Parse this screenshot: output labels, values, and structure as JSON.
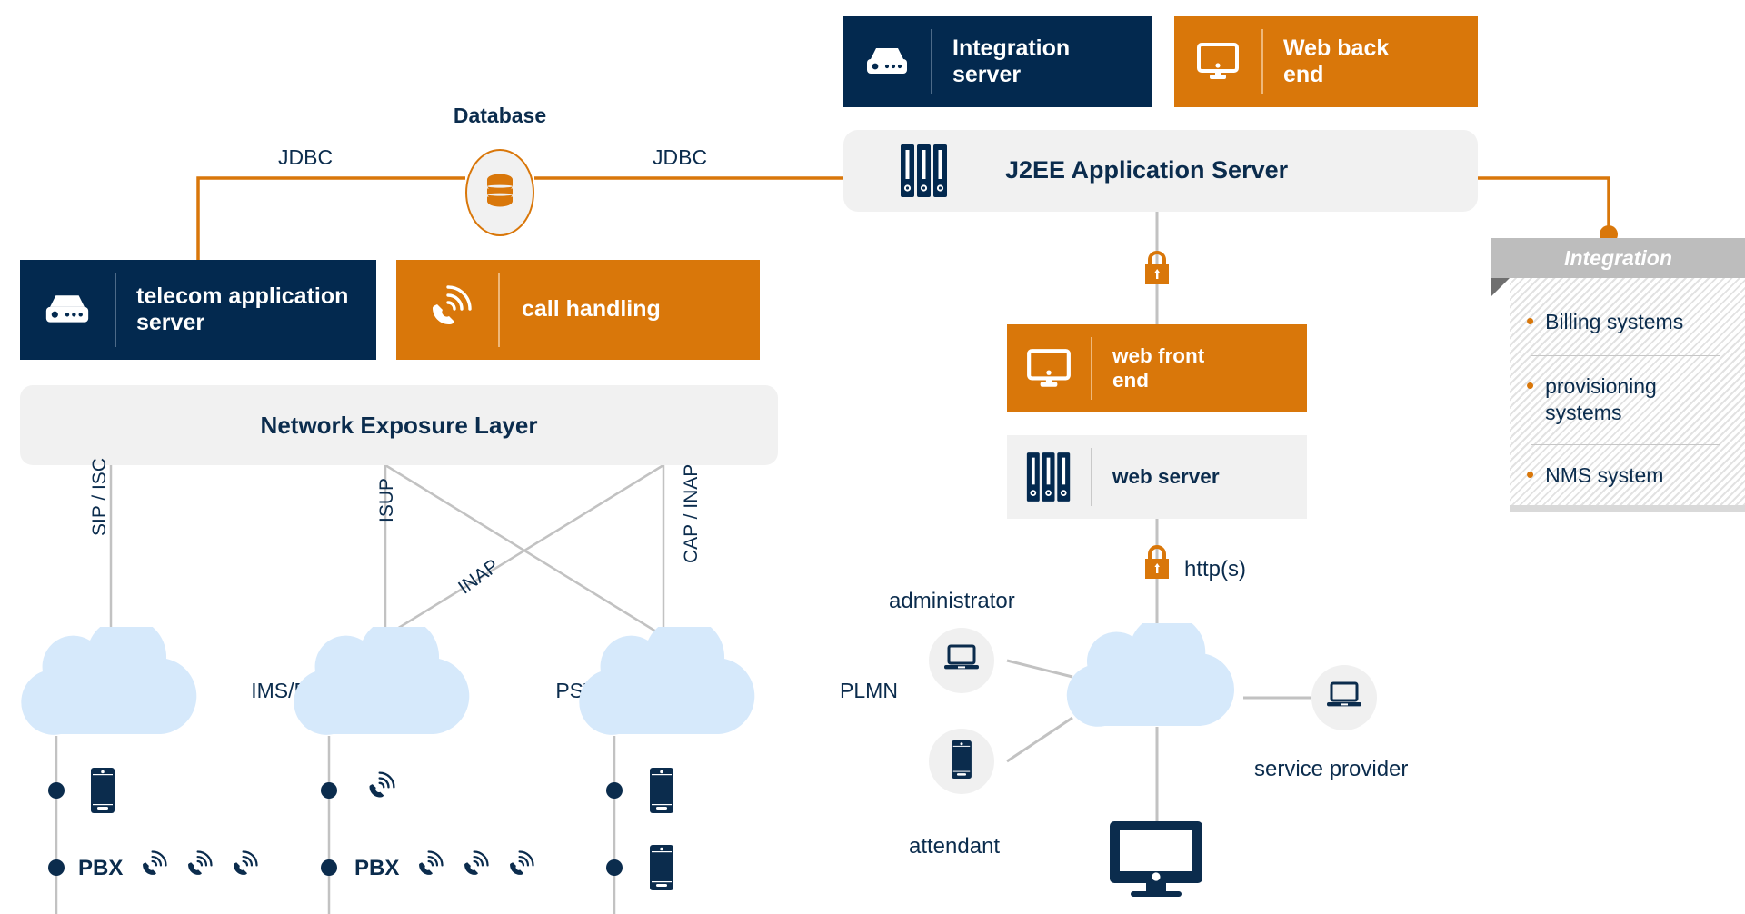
{
  "colors": {
    "navy": "#03294f",
    "orange": "#d9770a",
    "light_grey": "#f1f1f1",
    "cloud_blue": "#d6e9fb",
    "line_grey": "#c2c2c2",
    "header_grey": "#bdbdbd"
  },
  "tiles": {
    "integration_server": {
      "label": "Integration\nserver",
      "icon": "server-icon"
    },
    "web_back_end": {
      "label": "Web back\nend",
      "icon": "monitor-icon"
    },
    "j2ee": {
      "label": "J2EE Application Server",
      "icon": "binders-icon"
    },
    "telecom_application_server": {
      "label": "telecom application\nserver",
      "icon": "server-icon"
    },
    "call_handling": {
      "label": "call handling",
      "icon": "phone-ring-icon"
    },
    "network_exposure_layer": {
      "label": "Network Exposure Layer"
    },
    "web_front_end": {
      "label": "web front\nend",
      "icon": "monitor-icon"
    },
    "web_server": {
      "label": "web server",
      "icon": "binders-icon"
    }
  },
  "database": {
    "title": "Database",
    "icon": "database-cylinder-icon",
    "left_edge_label": "JDBC",
    "right_edge_label": "JDBC"
  },
  "protocol_labels": {
    "sip_isc": "SIP / ISC",
    "isup": "ISUP",
    "inap": "INAP",
    "cap_inap": "CAP / INAP",
    "https": "http(s)"
  },
  "networks": [
    {
      "name": "IMS/Pre-IMS",
      "protocol": "SIP / ISC"
    },
    {
      "name": "PSTN",
      "protocol": "ISUP"
    },
    {
      "name": "PLMN",
      "protocol": "CAP / INAP"
    }
  ],
  "endpoint_rows": {
    "ims": [
      {
        "devices": [
          "smartphone-icon"
        ]
      },
      {
        "pbx_label": "PBX",
        "devices": [
          "phone-ring-icon",
          "phone-ring-icon",
          "phone-ring-icon"
        ]
      }
    ],
    "pstn": [
      {
        "devices": [
          "phone-ring-icon"
        ]
      },
      {
        "pbx_label": "PBX",
        "devices": [
          "phone-ring-icon",
          "phone-ring-icon",
          "phone-ring-icon"
        ]
      }
    ],
    "plmn": [
      {
        "devices": [
          "smartphone-icon"
        ]
      },
      {
        "devices": [
          "smartphone-icon"
        ]
      }
    ]
  },
  "users": {
    "administrator": {
      "label": "administrator",
      "icon": "laptop-icon"
    },
    "attendant": {
      "label": "attendant",
      "icon": "smartphone-icon"
    },
    "service_provider": {
      "label": "service provider",
      "icon": "laptop-icon"
    },
    "desktop": {
      "icon": "monitor-icon"
    }
  },
  "integration_panel": {
    "title": "Integration",
    "items": [
      {
        "bullet": "•",
        "label": "Billing systems"
      },
      {
        "bullet": "•",
        "label": "provisioning\nsystems"
      },
      {
        "bullet": "•",
        "label": "NMS system"
      }
    ]
  }
}
